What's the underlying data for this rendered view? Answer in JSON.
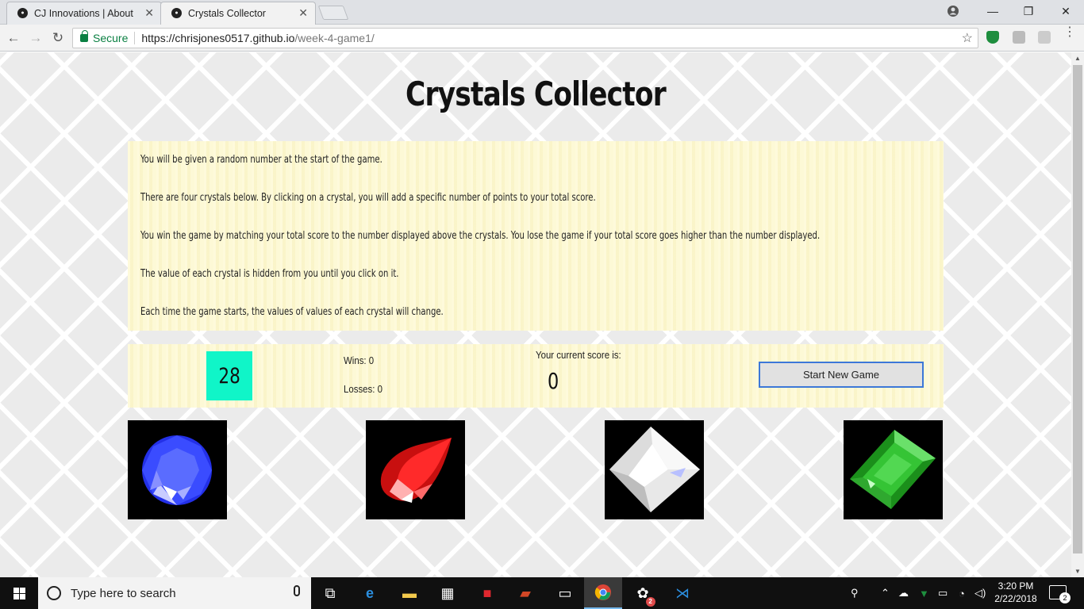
{
  "browser": {
    "tabs": [
      {
        "title": "CJ Innovations | About",
        "active": false
      },
      {
        "title": "Crystals Collector",
        "active": true
      }
    ],
    "secure_label": "Secure",
    "url_host": "https://chrisjones0517.github.io",
    "url_path": "/week-4-game1/"
  },
  "page": {
    "title": "Crystals Collector",
    "instructions": [
      "You will be given a random number at the start of the game.",
      "There are four crystals below. By clicking on a crystal, you will add a specific number of points to your total score.",
      "You win the game by matching your total score to the number displayed above the crystals. You lose the game if your total score goes higher than the number displayed.",
      "The value of each crystal is hidden from you until you click on it.",
      "Each time the game starts, the values of values of each crystal will change."
    ],
    "target_number": "28",
    "wins": "Wins: 0",
    "losses": "Losses: 0",
    "score_label": "Your current score is:",
    "score_value": "0",
    "new_game_button": "Start New Game",
    "crystals": [
      {
        "name": "blue-crystal",
        "color": "#2a3cf5"
      },
      {
        "name": "red-crystal",
        "color": "#e01818"
      },
      {
        "name": "white-crystal",
        "color": "#f0f0f0"
      },
      {
        "name": "green-crystal",
        "color": "#2fb82f"
      }
    ],
    "target_color": "#10f5c8"
  },
  "taskbar": {
    "search_placeholder": "Type here to search",
    "time": "3:20 PM",
    "date": "2/22/2018",
    "notifications": "2",
    "badge_count": "2"
  }
}
